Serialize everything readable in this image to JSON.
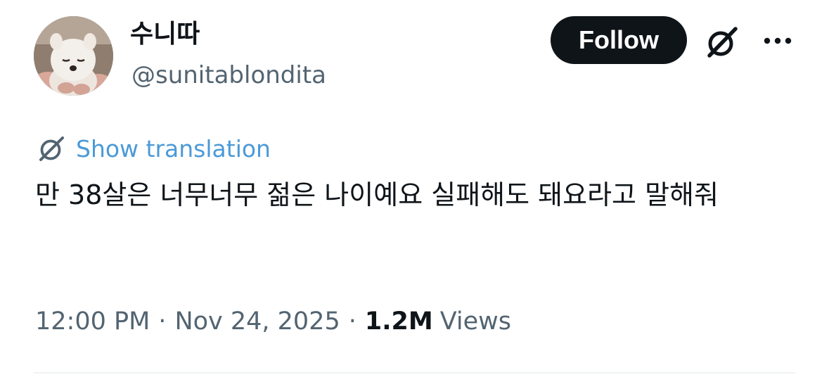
{
  "author": {
    "display_name": "수니따",
    "handle": "@sunitablondita"
  },
  "header": {
    "follow_label": "Follow",
    "grok_icon": "grok-icon",
    "more_icon": "more-dots-icon"
  },
  "translation": {
    "label": "Show translation",
    "icon": "grok-icon"
  },
  "tweet": {
    "text": "만 38살은 너무너무 젊은 나이예요 실패해도 돼요라고 말해줘"
  },
  "meta": {
    "time": "12:00 PM",
    "separator": "·",
    "date": "Nov 24, 2025",
    "views_count": "1.2M",
    "views_label": "Views"
  },
  "colors": {
    "text": "#0f1419",
    "muted": "#536471",
    "link": "#4b9ad8",
    "button": "#0f1419"
  }
}
